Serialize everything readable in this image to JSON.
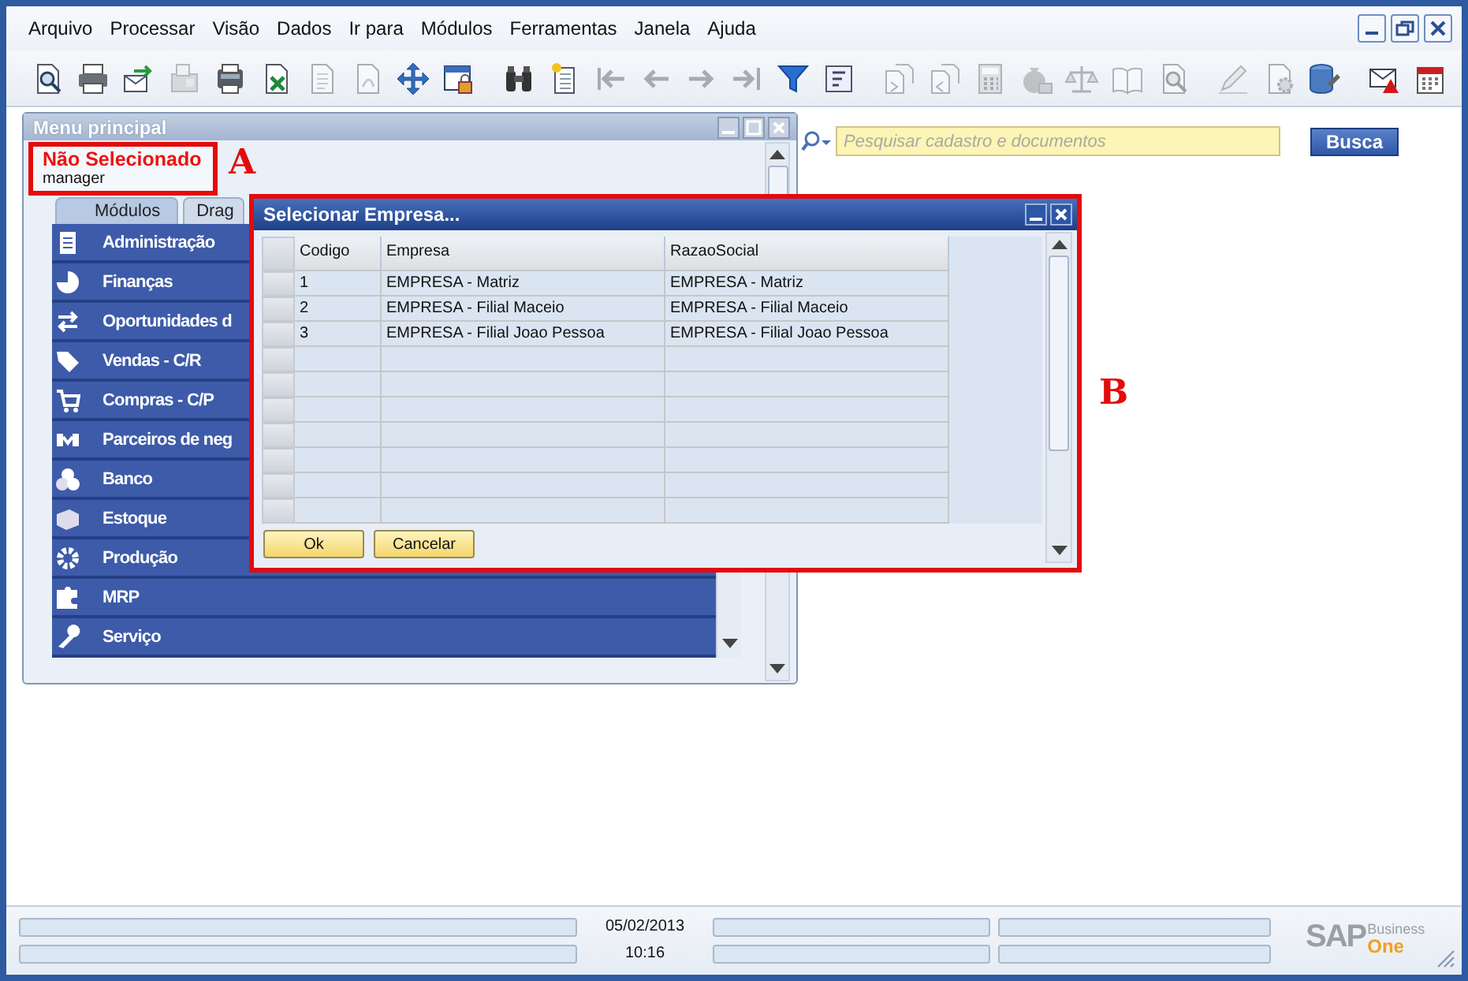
{
  "menu_bar": [
    "Arquivo",
    "Processar",
    "Visão",
    "Dados",
    "Ir para",
    "Módulos",
    "Ferramentas",
    "Janela",
    "Ajuda"
  ],
  "toolbar": [
    {
      "disabled": false
    },
    {
      "disabled": false
    },
    {
      "disabled": false
    },
    {
      "disabled": true
    },
    {
      "disabled": false
    },
    {
      "disabled": false
    },
    {
      "disabled": true
    },
    {
      "disabled": true
    },
    {
      "disabled": false
    },
    {
      "disabled": false
    },
    {
      "disabled": false
    },
    {
      "disabled": false
    },
    {
      "disabled": true
    },
    {
      "disabled": true
    },
    {
      "disabled": true
    },
    {
      "disabled": true
    },
    {
      "disabled": false
    },
    {
      "disabled": false
    },
    {
      "disabled": true
    },
    {
      "disabled": true
    },
    {
      "disabled": true
    },
    {
      "disabled": true
    },
    {
      "disabled": true
    },
    {
      "disabled": true
    },
    {
      "disabled": true
    },
    {
      "disabled": true
    },
    {
      "disabled": true
    },
    {
      "disabled": false
    },
    {
      "disabled": false
    },
    {
      "disabled": false
    }
  ],
  "search": {
    "placeholder": "Pesquisar cadastro e documentos",
    "button": "Busca"
  },
  "main_menu": {
    "title": "Menu principal",
    "company": "Não Selecionado",
    "user": "manager",
    "tabs": [
      {
        "label": "Módulos",
        "selected": true
      },
      {
        "label": "Drag",
        "selected": false
      }
    ],
    "modules": [
      "Administração",
      "Finanças",
      "Oportunidades d",
      "Vendas - C/R",
      "Compras - C/P",
      "Parceiros de neg",
      "Banco",
      "Estoque",
      "Produção",
      "MRP",
      "Serviço"
    ]
  },
  "dialog": {
    "title": "Selecionar Empresa...",
    "columns": [
      "Codigo",
      "Empresa",
      "RazaoSocial"
    ],
    "rows": [
      [
        "1",
        "EMPRESA - Matriz",
        "EMPRESA - Matriz"
      ],
      [
        "2",
        "EMPRESA - Filial Maceio",
        "EMPRESA - Filial Maceio"
      ],
      [
        "3",
        "EMPRESA - Filial Joao Pessoa",
        "EMPRESA - Filial Joao Pessoa"
      ]
    ],
    "buttons": [
      "Ok",
      "Cancelar"
    ]
  },
  "annotations": [
    "A",
    "B"
  ],
  "status_bar": {
    "date": "05/02/2013",
    "time": "10:16"
  },
  "logo": {
    "brand": "SAP",
    "line1": "Business",
    "line2": "One"
  }
}
